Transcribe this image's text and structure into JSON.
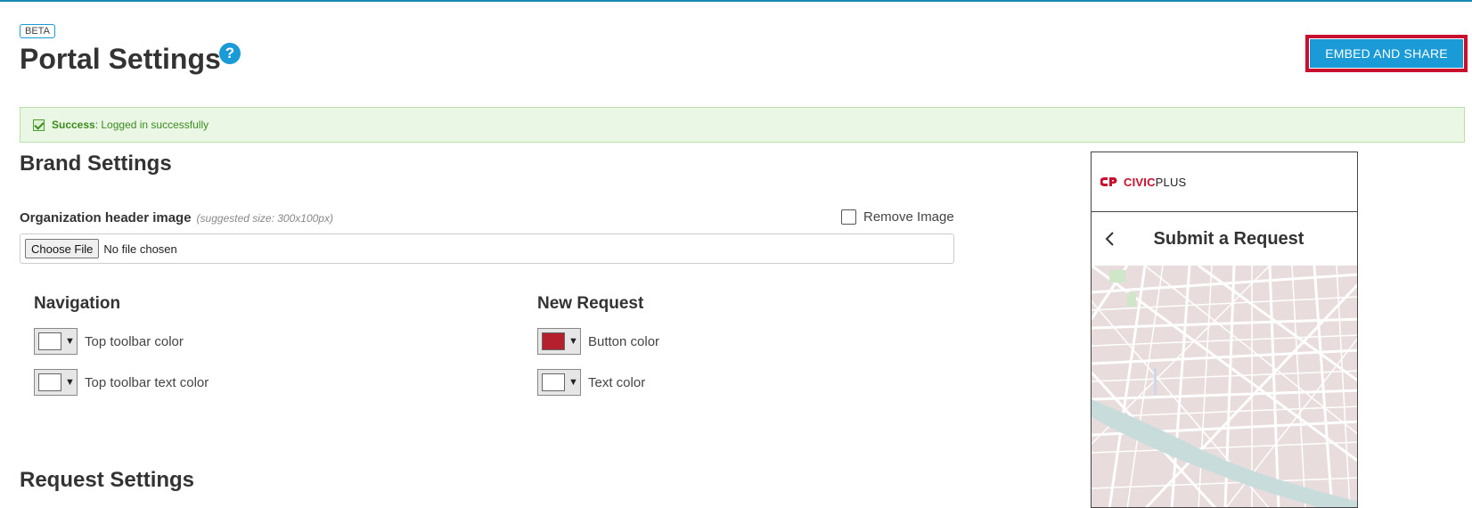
{
  "header": {
    "beta_badge": "BETA",
    "title": "Portal Settings",
    "help_icon": "?",
    "embed_button": "EMBED AND SHARE"
  },
  "alert": {
    "strong": "Success",
    "message": ": Logged in successfully"
  },
  "brand_settings": {
    "title": "Brand Settings",
    "header_image": {
      "label": "Organization header image",
      "hint": "(suggested size: 300x100px)",
      "remove_label": "Remove Image",
      "choose_button": "Choose File",
      "file_status": "No file chosen"
    },
    "navigation": {
      "title": "Navigation",
      "top_toolbar_color": {
        "label": "Top toolbar color",
        "color": "#ffffff"
      },
      "top_toolbar_text_color": {
        "label": "Top toolbar text color",
        "color": "#ffffff"
      }
    },
    "new_request": {
      "title": "New Request",
      "button_color": {
        "label": "Button color",
        "color": "#b5202e"
      },
      "text_color": {
        "label": "Text color",
        "color": "#ffffff"
      }
    }
  },
  "request_settings": {
    "title": "Request Settings"
  },
  "preview": {
    "logo_civic": "CIVIC",
    "logo_plus": "PLUS",
    "title": "Submit a Request",
    "brand_color": "#c8102e"
  },
  "colors": {
    "accent": "#1a9ad6",
    "highlight": "#c8102e",
    "success_bg": "#eaf7e4",
    "success_text": "#3c8b1f"
  }
}
